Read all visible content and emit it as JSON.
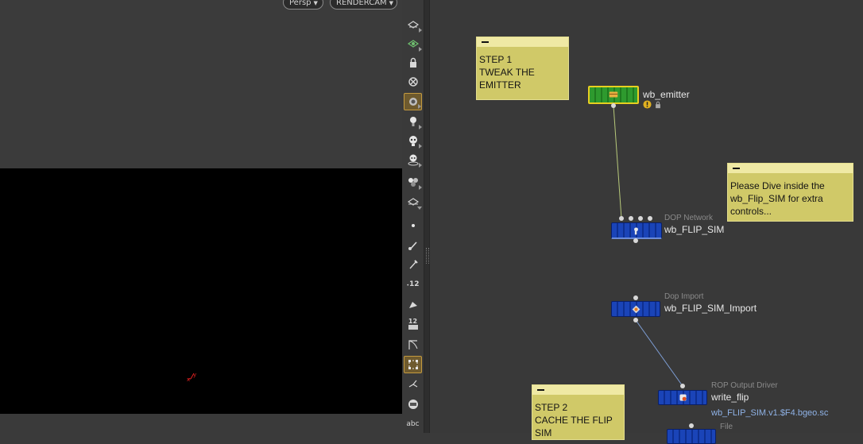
{
  "viewport": {
    "camera_menu_label": "Persp",
    "render_camera_label": "RENDERCAM",
    "background_color": "#000000"
  },
  "toolbar": {
    "icons": [
      "visibility-eye-icon",
      "ghost-display-icon",
      "lock-icon",
      "ignore-icon",
      "camera-view-icon",
      "light-bulb-icon",
      "skull-light-icon",
      "skull-handle-icon",
      "shading-icon",
      "wireframe-icon",
      "point-icon",
      "brush-icon",
      "pen-icon",
      "point-number-icon",
      "prim-icon",
      "vertex-number-icon",
      "uv-icon",
      "bounding-box-icon",
      "normal-icon",
      "background-icon",
      "text-label-icon"
    ],
    "labels": {
      "point_numbers": "12",
      "vertex_numbers": "12",
      "text_label": "abc"
    }
  },
  "network": {
    "sticky_notes": [
      {
        "id": "step1",
        "text": "STEP 1\nTWEAK THE\nEMITTER"
      },
      {
        "id": "dive",
        "text": "Please Dive inside the\nwb_Flip_SIM for extra\ncontrols..."
      },
      {
        "id": "step2",
        "text": "STEP 2\nCACHE THE FLIP\nSIM"
      }
    ],
    "nodes": {
      "emitter": {
        "name": "wb_emitter",
        "type": ""
      },
      "flip_sim": {
        "name": "wb_FLIP_SIM",
        "type": "DOP Network"
      },
      "flip_import": {
        "name": "wb_FLIP_SIM_Import",
        "type": "Dop Import"
      },
      "write_flip": {
        "name": "write_flip",
        "type": "ROP Output Driver",
        "output": "wb_FLIP_SIM.v1.$F4.bgeo.sc"
      },
      "file": {
        "type": "File"
      }
    },
    "colors": {
      "node_blue": "#1a44b8",
      "node_green": "#2e9a2e",
      "sticky": "#d0c968",
      "selected_outline": "#e8d020"
    }
  }
}
